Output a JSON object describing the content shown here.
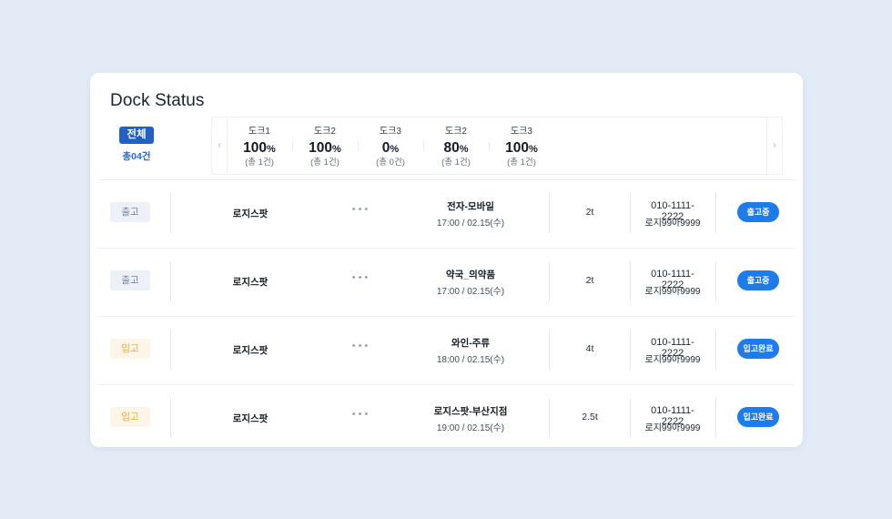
{
  "title": "Dock Status",
  "summary": {
    "all_label": "전체",
    "total_label": "총04건"
  },
  "nav": {
    "prev_icon": "chevron-left-icon",
    "prev_glyph": "‹",
    "next_icon": "chevron-right-icon",
    "next_glyph": "›"
  },
  "docks": [
    {
      "name": "도크1",
      "percent": "100",
      "unit": "%",
      "count": "(총 1건)"
    },
    {
      "name": "도크2",
      "percent": "100",
      "unit": "%",
      "count": "(총 1건)"
    },
    {
      "name": "도크3",
      "percent": "0",
      "unit": "%",
      "count": "(총 0건)"
    },
    {
      "name": "도크2",
      "percent": "80",
      "unit": "%",
      "count": "(총 1건)"
    },
    {
      "name": "도크3",
      "percent": "100",
      "unit": "%",
      "count": "(총 1건)"
    }
  ],
  "rows": [
    {
      "type": "출고",
      "type_kind": "out",
      "company": "로지스팟",
      "more": "•••",
      "goods": "전자-모바일",
      "time": "17:00 / 02.15(수)",
      "ton": "2t",
      "phone": "010-1111-2222",
      "plate": "로지99아9999",
      "status": "출고중"
    },
    {
      "type": "출고",
      "type_kind": "out",
      "company": "로지스팟",
      "more": "•••",
      "goods": "약국_의약품",
      "time": "17:00 / 02.15(수)",
      "ton": "2t",
      "phone": "010-1111-2222",
      "plate": "로지99아9999",
      "status": "출고중"
    },
    {
      "type": "입고",
      "type_kind": "in",
      "company": "로지스팟",
      "more": "•••",
      "goods": "와인-주류",
      "time": "18:00 / 02.15(수)",
      "ton": "4t",
      "phone": "010-1111-2222",
      "plate": "로지99아9999",
      "status": "입고완료"
    },
    {
      "type": "입고",
      "type_kind": "in",
      "company": "로지스팟",
      "more": "•••",
      "goods": "로지스팟-부산지점",
      "time": "19:00 / 02.15(수)",
      "ton": "2.5t",
      "phone": "010-1111-2222",
      "plate": "로지99아9999",
      "status": "입고완료"
    }
  ],
  "colors": {
    "accent": "#1e7bea",
    "badge_blue": "#2360c4",
    "in_text": "#ecaa3c",
    "out_text": "#6b7f9c",
    "background": "#e2ebf6"
  }
}
